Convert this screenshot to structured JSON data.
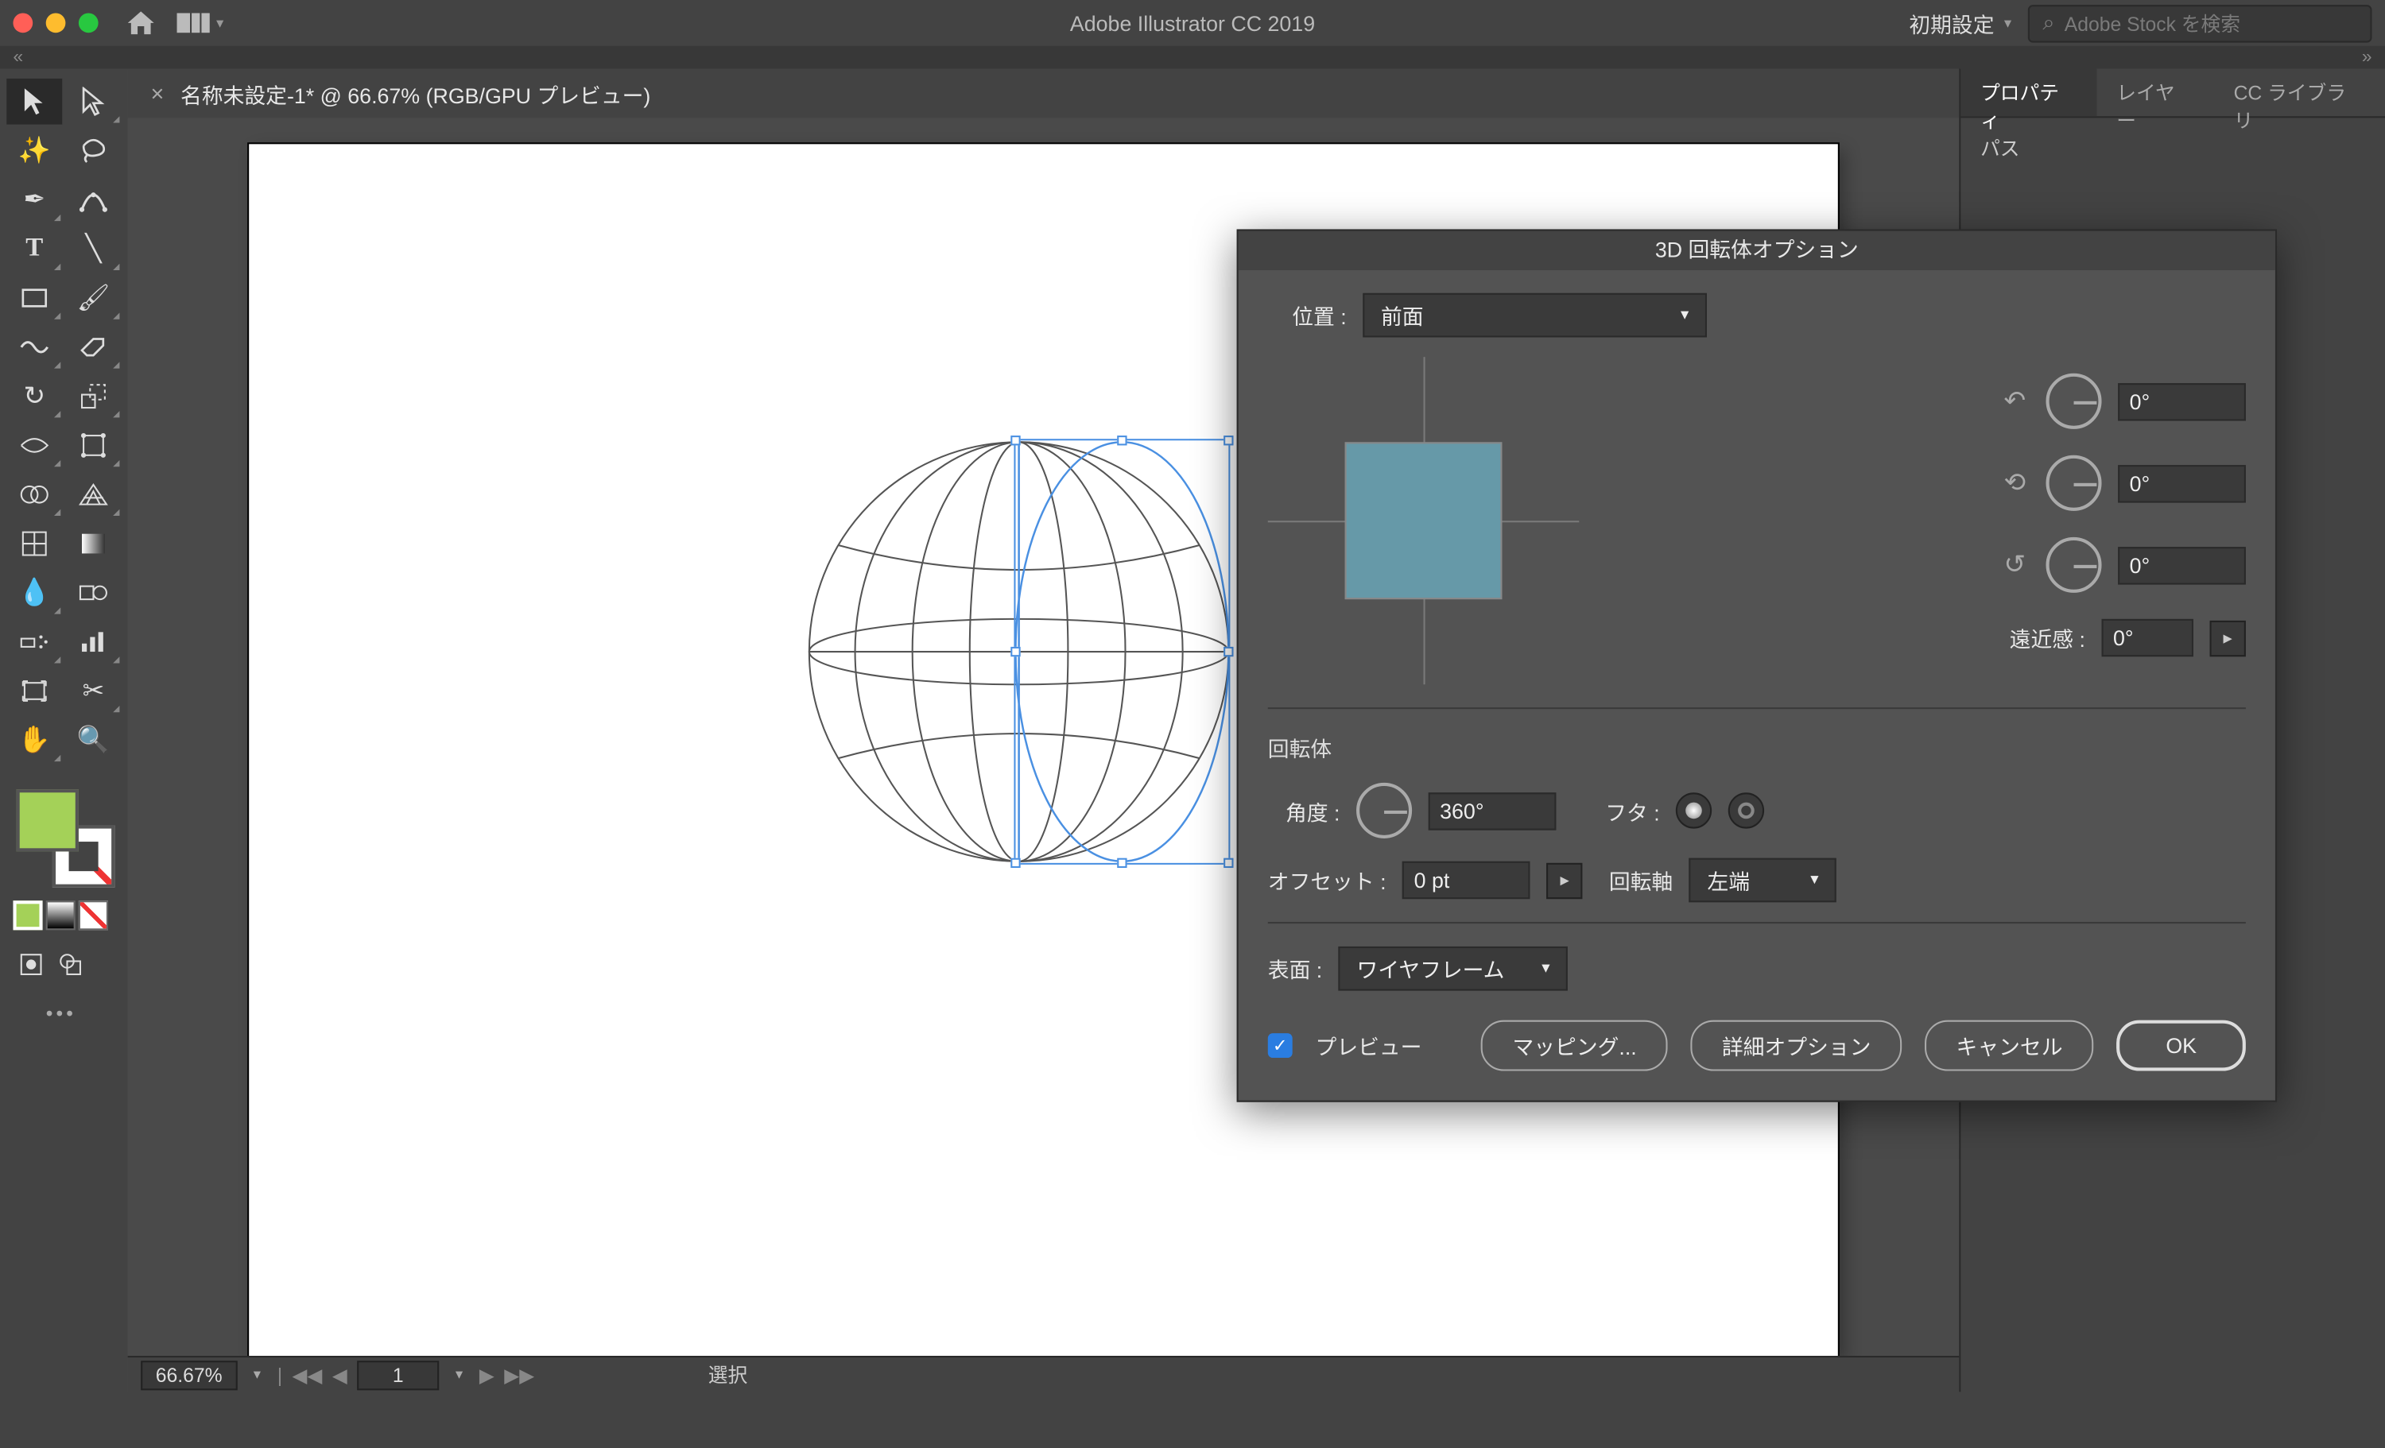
{
  "app_title": "Adobe Illustrator CC 2019",
  "workspace": {
    "label": "初期設定"
  },
  "search": {
    "placeholder": "Adobe Stock を検索"
  },
  "doc_tab": {
    "title": "名称未設定-1* @ 66.67% (RGB/GPU プレビュー)"
  },
  "right_panel": {
    "tabs": {
      "properties": "プロパティ",
      "layers": "レイヤー",
      "libraries": "CC ライブラリ"
    },
    "section": "パス"
  },
  "status": {
    "zoom": "66.67%",
    "artboard_nav": "1",
    "mode": "選択"
  },
  "dialog": {
    "title": "3D 回転体オプション",
    "position_label": "位置 :",
    "position_value": "前面",
    "rotx": "0°",
    "roty": "0°",
    "rotz": "0°",
    "perspective_label": "遠近感 :",
    "perspective_value": "0°",
    "revolve_section": "回転体",
    "angle_label": "角度 :",
    "angle_value": "360°",
    "cap_label": "フタ :",
    "offset_label": "オフセット :",
    "offset_value": "0 pt",
    "axis_label": "回転軸",
    "axis_value": "左端",
    "surface_label": "表面 :",
    "surface_value": "ワイヤフレーム",
    "preview_label": "プレビュー",
    "btn_map": "マッピング...",
    "btn_more": "詳細オプション",
    "btn_cancel": "キャンセル",
    "btn_ok": "OK"
  },
  "colors": {
    "fill": "#a4d158"
  }
}
